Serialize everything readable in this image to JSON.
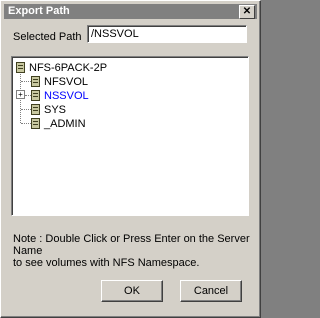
{
  "window": {
    "title": "Export Path",
    "close_icon": "close-icon",
    "close_glyph": "✕"
  },
  "selected_path": {
    "label": "Selected Path",
    "value": "/NSSVOL"
  },
  "tree": {
    "root": "NFS-6PACK-2P",
    "items": [
      {
        "label": "NFSVOL",
        "expandable": false,
        "selected": false
      },
      {
        "label": "NSSVOL",
        "expandable": true,
        "selected": true
      },
      {
        "label": "SYS",
        "expandable": false,
        "selected": false
      },
      {
        "label": "_ADMIN",
        "expandable": false,
        "selected": false
      }
    ],
    "expander_glyph": "+"
  },
  "note": {
    "line1": "Note : Double Click or Press Enter on the Server Name",
    "line2": "to see volumes with NFS Namespace."
  },
  "buttons": {
    "ok": "OK",
    "cancel": "Cancel"
  },
  "colors": {
    "title_bar": "#808080",
    "selected_text": "#0000ff",
    "dialog_face": "#d4d0c8"
  }
}
